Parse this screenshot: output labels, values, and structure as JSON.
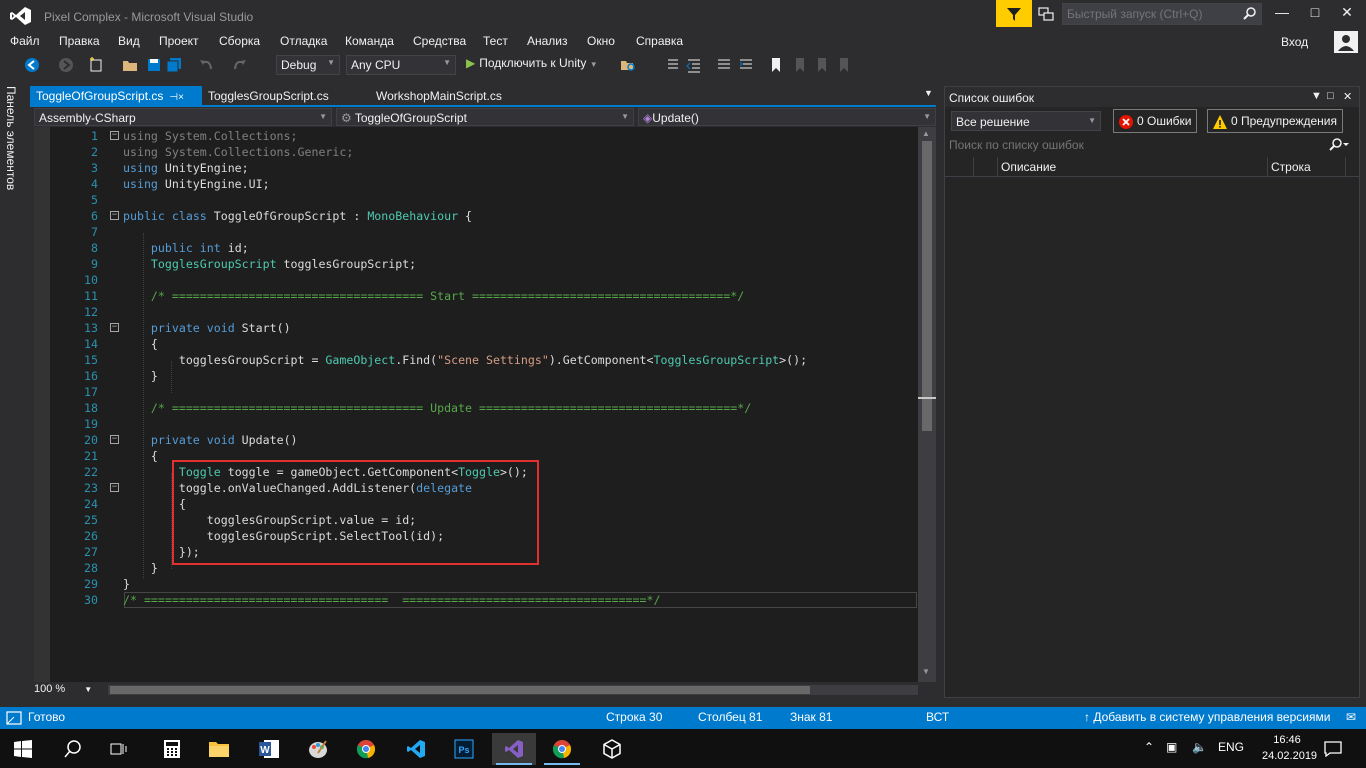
{
  "window": {
    "title": "Pixel Complex - Microsoft Visual Studio",
    "quick_launch_placeholder": "Быстрый запуск (Ctrl+Q)"
  },
  "menu": [
    "Файл",
    "Правка",
    "Вид",
    "Проект",
    "Сборка",
    "Отладка",
    "Команда",
    "Средства",
    "Тест",
    "Анализ",
    "Окно",
    "Справка"
  ],
  "account": {
    "login_label": "Вход"
  },
  "toolbar": {
    "configuration": "Debug",
    "platform": "Any CPU",
    "attach_label": "Подключить к Unity"
  },
  "side_panel": {
    "label": "Панель элементов"
  },
  "tabs": [
    {
      "label": "ToggleOfGroupScript.cs",
      "active": true,
      "pin": "⊣×"
    },
    {
      "label": "TogglesGroupScript.cs",
      "active": false
    },
    {
      "label": "WorkshopMainScript.cs",
      "active": false
    }
  ],
  "navbar": {
    "project": "Assembly-CSharp",
    "class": "ToggleOfGroupScript",
    "member": "Update()"
  },
  "editor": {
    "line_numbers": [
      "1",
      "2",
      "3",
      "4",
      "5",
      "6",
      "7",
      "8",
      "9",
      "10",
      "11",
      "12",
      "13",
      "14",
      "15",
      "16",
      "17",
      "18",
      "19",
      "20",
      "21",
      "22",
      "23",
      "24",
      "25",
      "26",
      "27",
      "28",
      "29",
      "30"
    ],
    "lines": [
      "using System.Collections;",
      "using System.Collections.Generic;",
      "using UnityEngine;",
      "using UnityEngine.UI;",
      "",
      "public class ToggleOfGroupScript : MonoBehaviour {",
      "",
      "    public int id;",
      "    TogglesGroupScript togglesGroupScript;",
      "",
      "    /* ==================================== Start =====================================*/",
      "",
      "    private void Start()",
      "    {",
      "        togglesGroupScript = GameObject.Find(\"Scene Settings\").GetComponent<TogglesGroupScript>();",
      "    }",
      "",
      "    /* ==================================== Update =====================================*/",
      "",
      "    private void Update()",
      "    {",
      "        Toggle toggle = gameObject.GetComponent<Toggle>();",
      "        toggle.onValueChanged.AddListener(delegate",
      "        {",
      "            togglesGroupScript.value = id;",
      "            togglesGroupScript.SelectTool(id);",
      "        });",
      "    }",
      "}",
      "/* ===================================  ===================================*/"
    ],
    "zoom": "100 %"
  },
  "error_list": {
    "title": "Список ошибок",
    "scope": "Все решение",
    "errors_label": "0 Ошибки",
    "warnings_label": "0 Предупреждения",
    "search_placeholder": "Поиск по списку ошибок",
    "columns": [
      "Описание",
      "Строка"
    ]
  },
  "status": {
    "ready": "Готово",
    "line": "Строка 30",
    "column": "Столбец 81",
    "char": "Знак 81",
    "mode": "ВСТ",
    "source_control": "Добавить в систему управления версиями"
  },
  "taskbar": {
    "language": "ENG",
    "time": "16:46",
    "date": "24.02.2019"
  },
  "colors": {
    "accent": "#007acc",
    "keyword": "#569cd6",
    "type": "#4ec9b0",
    "comment": "#57a64a",
    "string": "#d69d85",
    "highlight_box": "#e03030"
  }
}
